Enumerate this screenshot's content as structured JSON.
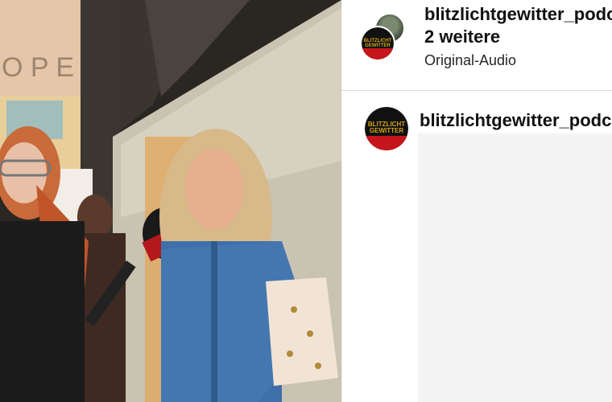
{
  "post": {
    "author_username": "blitzlichtgewitter_podc",
    "collaborators_text": "2 weitere",
    "audio_label": "Original-Audio"
  },
  "caption": {
    "username": "blitzlichtgewitter_podc"
  },
  "avatar": {
    "logo_text": "BLITZLICHT GEWITTER",
    "logo_color": "#d4a21a",
    "bg_color": "#111111",
    "accent_color": "#c4161c"
  },
  "icons": [
    "avatar-icon",
    "microphone-icon"
  ]
}
